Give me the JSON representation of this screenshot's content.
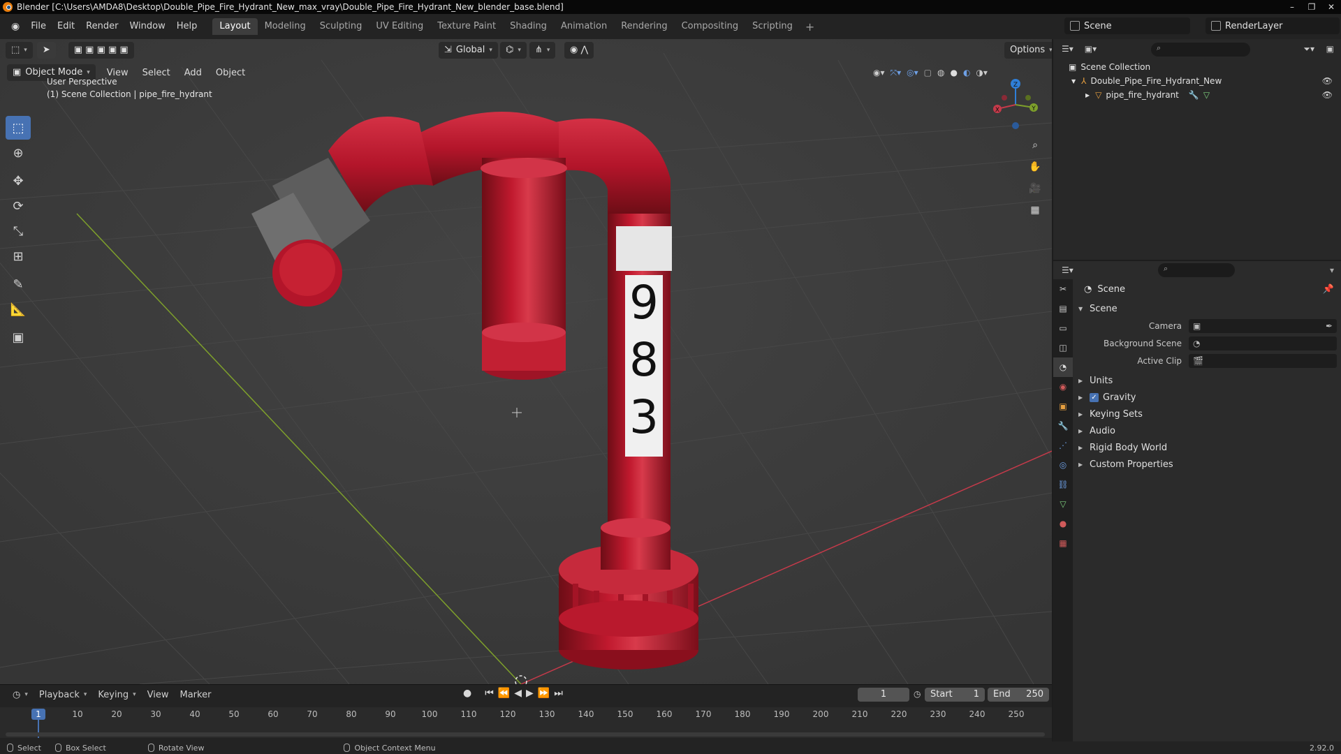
{
  "window": {
    "title": "Blender [C:\\Users\\AMDA8\\Desktop\\Double_Pipe_Fire_Hydrant_New_max_vray\\Double_Pipe_Fire_Hydrant_New_blender_base.blend]",
    "minimize": "–",
    "maximize": "❐",
    "close": "✕"
  },
  "menus": [
    "File",
    "Edit",
    "Render",
    "Window",
    "Help"
  ],
  "workspaces": [
    "Layout",
    "Modeling",
    "Sculpting",
    "UV Editing",
    "Texture Paint",
    "Shading",
    "Animation",
    "Rendering",
    "Compositing",
    "Scripting"
  ],
  "workspace_add": "+",
  "scene_selector": {
    "value": "Scene"
  },
  "layer_selector": {
    "value": "RenderLayer"
  },
  "viewport": {
    "mode": "Object Mode",
    "menus": [
      "View",
      "Select",
      "Add",
      "Object"
    ],
    "transform_orientation": "Global",
    "options": "Options",
    "perspective_label": "User Perspective",
    "collection_label": "(1) Scene Collection | pipe_fire_hydrant",
    "hydrant_number": [
      "9",
      "8",
      "3"
    ],
    "gizmo": {
      "x": "X",
      "y": "Y",
      "z": "Z"
    }
  },
  "tools": [
    "select-box",
    "cursor",
    "move",
    "rotate",
    "scale",
    "transform",
    "annotate",
    "measure",
    "add-cube"
  ],
  "timeline": {
    "menus": [
      "Playback",
      "Keying",
      "View",
      "Marker"
    ],
    "current_frame": "1",
    "start_label": "Start",
    "start": "1",
    "end_label": "End",
    "end": "250",
    "ruler_ticks": [
      "1",
      "10",
      "20",
      "30",
      "40",
      "50",
      "60",
      "70",
      "80",
      "90",
      "100",
      "110",
      "120",
      "130",
      "140",
      "150",
      "160",
      "170",
      "180",
      "190",
      "200",
      "210",
      "220",
      "230",
      "240",
      "250"
    ]
  },
  "outliner": {
    "root": "Scene Collection",
    "items": [
      {
        "label": "Double_Pipe_Fire_Hydrant_New"
      },
      {
        "label": "pipe_fire_hydrant"
      }
    ]
  },
  "properties": {
    "context": "Scene",
    "section": "Scene",
    "fields": [
      {
        "label": "Camera",
        "value": ""
      },
      {
        "label": "Background Scene",
        "value": ""
      },
      {
        "label": "Active Clip",
        "value": ""
      }
    ],
    "panels": [
      "Units",
      "Gravity",
      "Keying Sets",
      "Audio",
      "Rigid Body World",
      "Custom Properties"
    ],
    "gravity_checked": true
  },
  "statusbar": {
    "select": "Select",
    "box_select": "Box Select",
    "rotate_view": "Rotate View",
    "context_menu": "Object Context Menu",
    "version": "2.92.0"
  },
  "colors": {
    "accent": "#4772b3",
    "hydrant": "#b3152a",
    "x_axis": "#c53a4a",
    "y_axis": "#7ea02b",
    "z_axis": "#2f7fd8"
  }
}
